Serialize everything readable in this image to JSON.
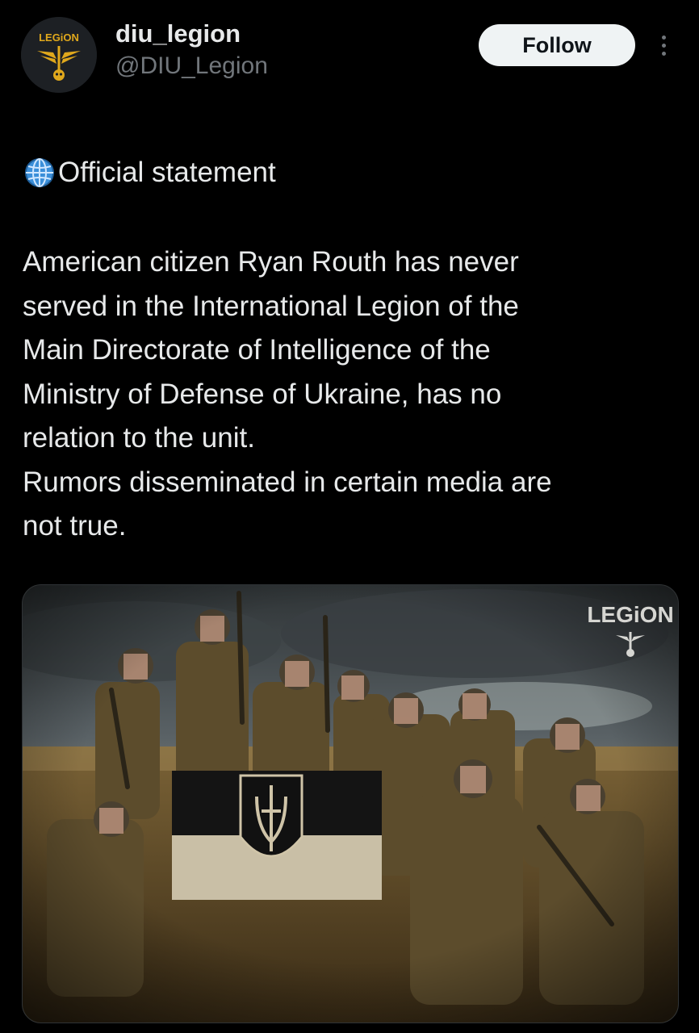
{
  "header": {
    "avatar_text": "LEGiON",
    "display_name": "diu_legion",
    "handle": "@DIU_Legion",
    "follow_label": "Follow"
  },
  "tweet": {
    "statement_emoji": "globe-icon",
    "statement_title": "Official statement",
    "body": "American citizen Ryan Routh has never\nserved in the International Legion of the\nMain Directorate of Intelligence of the\nMinistry of Defense of Ukraine, has no\nrelation to the unit.\nRumors disseminated in certain media are\nnot true."
  },
  "media": {
    "watermark_text": "LEGiON"
  },
  "colors": {
    "background": "#000000",
    "text_primary": "#e7e9ea",
    "text_secondary": "#71767b",
    "follow_bg": "#eff3f4",
    "brand_gold": "#e0a81c"
  }
}
